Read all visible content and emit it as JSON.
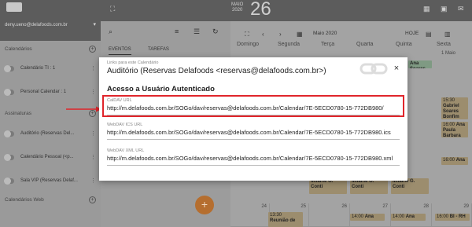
{
  "sidebar": {
    "email": "deny.ueno@delafoods.com.br",
    "sections": {
      "calendars": "Calendários",
      "subscriptions": "Assinaturas",
      "web": "Calendários Web"
    },
    "calendars": [
      {
        "label": "Calendário TI : 1"
      },
      {
        "label": "Personal Calendar : 1"
      }
    ],
    "subscriptions": [
      {
        "label": "Auditório (Reservas Del..."
      },
      {
        "label": "Calendário Pessoal (<p..."
      },
      {
        "label": "Sala VIP (Reservas Delaf..."
      }
    ]
  },
  "topbar": {
    "month_label": "MAIO",
    "year_label": "2020",
    "day_number": "26"
  },
  "listpane": {
    "tabs": [
      "EVENTOS",
      "TAREFAS"
    ],
    "fab_label": "+"
  },
  "calendar": {
    "month_label": "Maio 2020",
    "today_button": "HOJE",
    "weekdays": [
      "Domingo",
      "Segunda",
      "Terça",
      "Quarta",
      "Quinta",
      "Sexta"
    ],
    "first_cell": "1 Maio",
    "day_numbers": [
      "24",
      "25",
      "26",
      "27",
      "28",
      "29"
    ],
    "events": [
      {
        "time": "15:30",
        "title": "Gabriel Soares Bonfim"
      },
      {
        "time": "16:00",
        "title": "Ana Paula Barbara"
      },
      {
        "time": "16:00",
        "title": "Ana"
      },
      {
        "time": "",
        "title": "Milaine G. Conti"
      },
      {
        "time": "",
        "title": "Milaine G. Conti"
      },
      {
        "time": "",
        "title": "Milaine G. Conti"
      },
      {
        "time": "13:30",
        "title": "Reunião de"
      },
      {
        "time": "14:00",
        "title": "Ana"
      },
      {
        "time": "14:00",
        "title": "Ana"
      },
      {
        "time": "16:00",
        "title": "BI - RH"
      },
      {
        "time": "",
        "title": "Ana Soares"
      }
    ]
  },
  "modal": {
    "subtitle": "Links para este Calendário",
    "title": "Auditório (Reservas Delafoods <reservas@delafoods.com.br>)",
    "headline": "Acesso a Usuário Autenticado",
    "close_label": "×",
    "fields": [
      {
        "label": "CalDAV URL",
        "value": "http://m.delafoods.com.br/SOGo/dav/reservas@delafoods.com.br/Calendar/7E-5ECD0780-15-772DB980/"
      },
      {
        "label": "WebDAV ICS URL",
        "value": "http://m.delafoods.com.br/SOGo/dav/reservas@delafoods.com.br/Calendar/7E-5ECD0780-15-772DB980.ics"
      },
      {
        "label": "WebDAV XML URL",
        "value": "http://m.delafoods.com.br/SOGo/dav/reservas@delafoods.com.br/Calendar/7E-5ECD0780-15-772DB980.xml"
      }
    ]
  },
  "colors": {
    "highlight": "#e0252b",
    "accent": "#b56e2f"
  }
}
